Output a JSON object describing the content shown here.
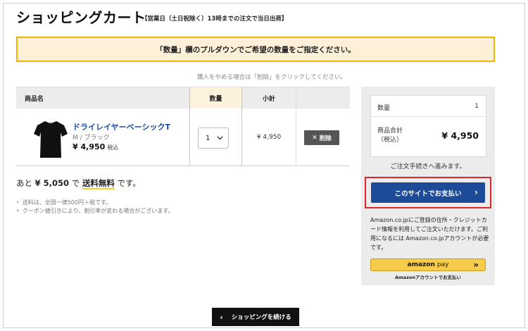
{
  "page": {
    "title": "ショッピングカート",
    "subtitle": "【営業日（土日祝除く）13時までの注文で当日出荷】",
    "notice": "「数量」欄のプルダウンでご希望の数量をご指定ください。",
    "delete_hint": "購入をやめる場合は「削除」をクリックしてください。"
  },
  "cart_table": {
    "headers": {
      "product": "商品名",
      "quantity": "数量",
      "subtotal": "小計"
    },
    "items": [
      {
        "name": "ドライレイヤーベーシックT",
        "variant": "M / ブラック",
        "price": "¥ 4,950",
        "tax_label": "税込",
        "quantity": "1",
        "subtotal": "¥ 4,950",
        "delete_label": "削除",
        "image_icon": "black-tshirt-icon"
      }
    ]
  },
  "free_shipping": {
    "prefix": "あと",
    "amount": "¥ 5,050",
    "mid": "で",
    "highlight": "送料無料",
    "suffix": "です。"
  },
  "notes": [
    "送料は、全国一律500円＋税です。",
    "クーポン値引きにより、割引率が変わる場合がございます。"
  ],
  "summary": {
    "qty_label": "数量",
    "qty_value": "1",
    "total_label_line1": "商品合計",
    "total_label_line2": "（税込）",
    "total_value": "¥ 4,950",
    "proceed_text": "ご注文手続きへ進みます。",
    "pay_button": "このサイトでお支払い",
    "amazon_text": "Amazon.co.jpにご登録の住所・クレジットカード情報を利用してご注文いただけます。ご利用になるには Amazon.co.jpアカウントが必要です。",
    "amazon_button_brand": "amazon",
    "amazon_button_sub": "pay",
    "amazon_caption": "Amazonアカウントでお支払い"
  },
  "continue_button": "ショッピングを続ける",
  "colors": {
    "notice_bg": "#fdf0d8",
    "notice_border": "#f0b400",
    "product_link": "#1a4da1",
    "pay_button": "#1d4b97",
    "highlight_outline": "#e0252c",
    "amazon_button": "#f7cc4a"
  }
}
